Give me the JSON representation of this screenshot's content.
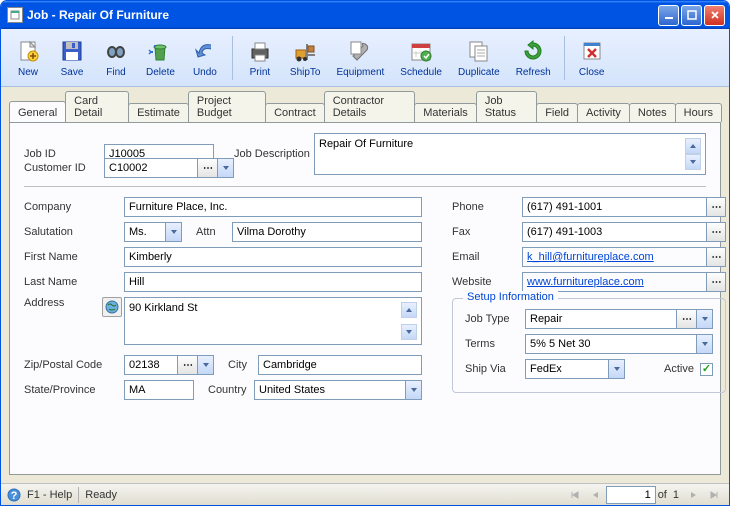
{
  "window": {
    "title": "Job - Repair Of Furniture"
  },
  "titlebarButtons": {
    "min": "_",
    "max": "□",
    "close": "X"
  },
  "toolbar": [
    {
      "id": "new",
      "label": "New",
      "icon": "doc"
    },
    {
      "id": "save",
      "label": "Save",
      "icon": "floppy"
    },
    {
      "id": "find",
      "label": "Find",
      "icon": "binoc"
    },
    {
      "id": "delete",
      "label": "Delete",
      "icon": "trash"
    },
    {
      "id": "undo",
      "label": "Undo",
      "icon": "undo",
      "sep_after": true
    },
    {
      "id": "print",
      "label": "Print",
      "icon": "printer"
    },
    {
      "id": "shipto",
      "label": "ShipTo",
      "icon": "forklift"
    },
    {
      "id": "equipment",
      "label": "Equipment",
      "icon": "wrench"
    },
    {
      "id": "schedule",
      "label": "Schedule",
      "icon": "calendar"
    },
    {
      "id": "duplicate",
      "label": "Duplicate",
      "icon": "dup"
    },
    {
      "id": "refresh",
      "label": "Refresh",
      "icon": "refresh",
      "sep_after": true
    },
    {
      "id": "close",
      "label": "Close",
      "icon": "close"
    }
  ],
  "tabs": [
    "General",
    "Card Detail",
    "Estimate",
    "Project Budget",
    "Contract",
    "Contractor Details",
    "Materials",
    "Job Status",
    "Field",
    "Activity",
    "Notes",
    "Hours"
  ],
  "activeTab": "General",
  "labels": {
    "jobId": "Job ID",
    "jobDesc": "Job Description",
    "customerId": "Customer ID",
    "company": "Company",
    "salutation": "Salutation",
    "attn": "Attn",
    "firstName": "First Name",
    "lastName": "Last Name",
    "address": "Address",
    "zip": "Zip/Postal Code",
    "city": "City",
    "state": "State/Province",
    "country": "Country",
    "phone": "Phone",
    "fax": "Fax",
    "email": "Email",
    "website": "Website",
    "setupInfo": "Setup Information",
    "jobType": "Job Type",
    "terms": "Terms",
    "shipVia": "Ship Via",
    "active": "Active"
  },
  "fields": {
    "jobId": "J10005",
    "jobDesc": "Repair Of Furniture",
    "customerId": "C10002",
    "company": "Furniture Place, Inc.",
    "salutation": "Ms.",
    "attn": "Vilma Dorothy",
    "firstName": "Kimberly",
    "lastName": "Hill",
    "address": "90 Kirkland St",
    "zip": "02138",
    "city": "Cambridge",
    "state": "MA",
    "country": "United States",
    "phone": "(617) 491-1001",
    "fax": "(617) 491-1003",
    "email": "k_hill@furnitureplace.com",
    "website": "www.furnitureplace.com",
    "jobType": "Repair",
    "terms": "5% 5 Net 30",
    "shipVia": "FedEx",
    "active": true
  },
  "status": {
    "help": "F1 - Help",
    "ready": "Ready",
    "page": "1",
    "of": "of",
    "total": "1"
  }
}
